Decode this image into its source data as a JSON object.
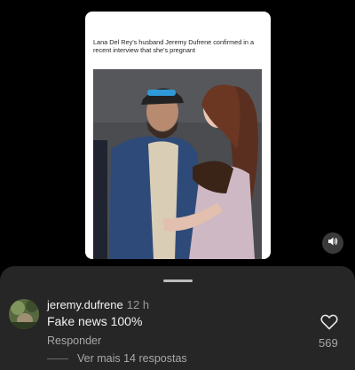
{
  "post": {
    "caption": "Lana Del Rey's husband Jeremy Dufrene confirmed in a recent interview that she's pregnant"
  },
  "comment": {
    "username": "jeremy.dufrene",
    "time": "12 h",
    "text": "Fake news 100%",
    "reply_label": "Responder",
    "likes": "569",
    "view_more": "Ver mais 14 respostas"
  },
  "icons": {
    "sound": "speaker-icon",
    "like": "heart-icon"
  },
  "colors": {
    "sheet_bg": "#262626",
    "secondary_text": "#a8a8a8"
  }
}
